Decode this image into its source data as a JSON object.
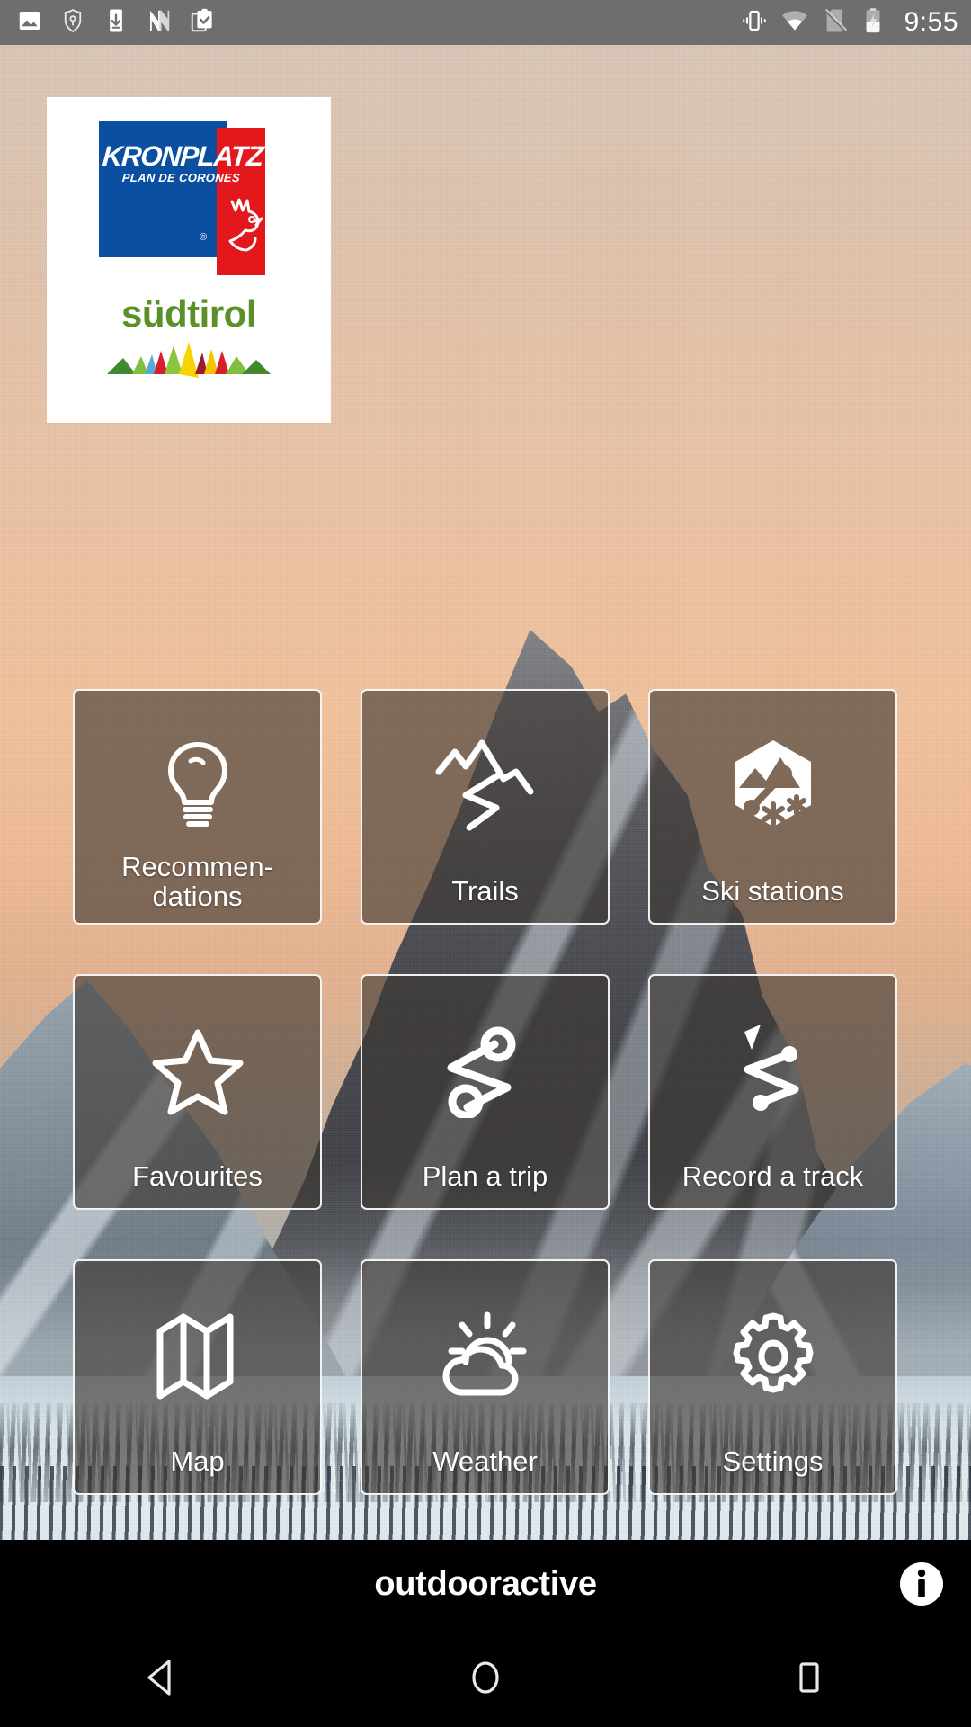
{
  "statusbar": {
    "time": "9:55",
    "left_icons": [
      {
        "name": "photo-icon",
        "label": "photo"
      },
      {
        "name": "vpn-key-shield-icon",
        "label": "vpn"
      },
      {
        "name": "download-to-device-icon",
        "label": "download"
      },
      {
        "name": "nougat-n-icon",
        "label": "N"
      },
      {
        "name": "clipboard-check-icon",
        "label": "clipboard"
      }
    ],
    "right_icons": [
      {
        "name": "vibrate-icon",
        "label": "vibrate"
      },
      {
        "name": "wifi-icon",
        "label": "wifi"
      },
      {
        "name": "no-sim-icon",
        "label": "no-sim"
      },
      {
        "name": "battery-charging-icon",
        "label": "battery charging"
      }
    ]
  },
  "logo": {
    "brand_title": "KRONPLATZ",
    "brand_subtitle": "PLAN DE CORONES",
    "registered_mark": "®",
    "region": "südtirol",
    "colors": {
      "blue": "#0b50a0",
      "red": "#e2181c",
      "green": "#5b9028"
    }
  },
  "grid": {
    "tiles": [
      {
        "id": "recommendations",
        "label": "Recommen-\ndations",
        "icon": "lightbulb-icon",
        "two_line": true
      },
      {
        "id": "trails",
        "label": "Trails",
        "icon": "mountain-trail-icon",
        "two_line": false
      },
      {
        "id": "ski-stations",
        "label": "Ski stations",
        "icon": "ski-station-badge-icon",
        "two_line": false
      },
      {
        "id": "favourites",
        "label": "Favourites",
        "icon": "star-outline-icon",
        "two_line": false
      },
      {
        "id": "plan-a-trip",
        "label": "Plan a trip",
        "icon": "route-waypoints-icon",
        "two_line": false
      },
      {
        "id": "record-a-track",
        "label": "Record a track",
        "icon": "record-track-arrow-icon",
        "two_line": false
      },
      {
        "id": "map",
        "label": "Map",
        "icon": "folded-map-icon",
        "two_line": false
      },
      {
        "id": "weather",
        "label": "Weather",
        "icon": "sun-cloud-icon",
        "two_line": false
      },
      {
        "id": "settings",
        "label": "Settings",
        "icon": "gear-icon",
        "two_line": false
      }
    ]
  },
  "brandbar": {
    "text": "outdooractive",
    "info_icon": "info-icon"
  },
  "navbar": {
    "back": "back-icon",
    "home": "home-icon",
    "recents": "recents-icon"
  },
  "theme": {
    "status_bar_bg": "#6e6e6e",
    "tile_bg": "rgba(60,55,50,0.62)",
    "tile_border": "#ffffff",
    "brandbar_bg": "#000000",
    "text_on_tile": "#ffffff"
  }
}
